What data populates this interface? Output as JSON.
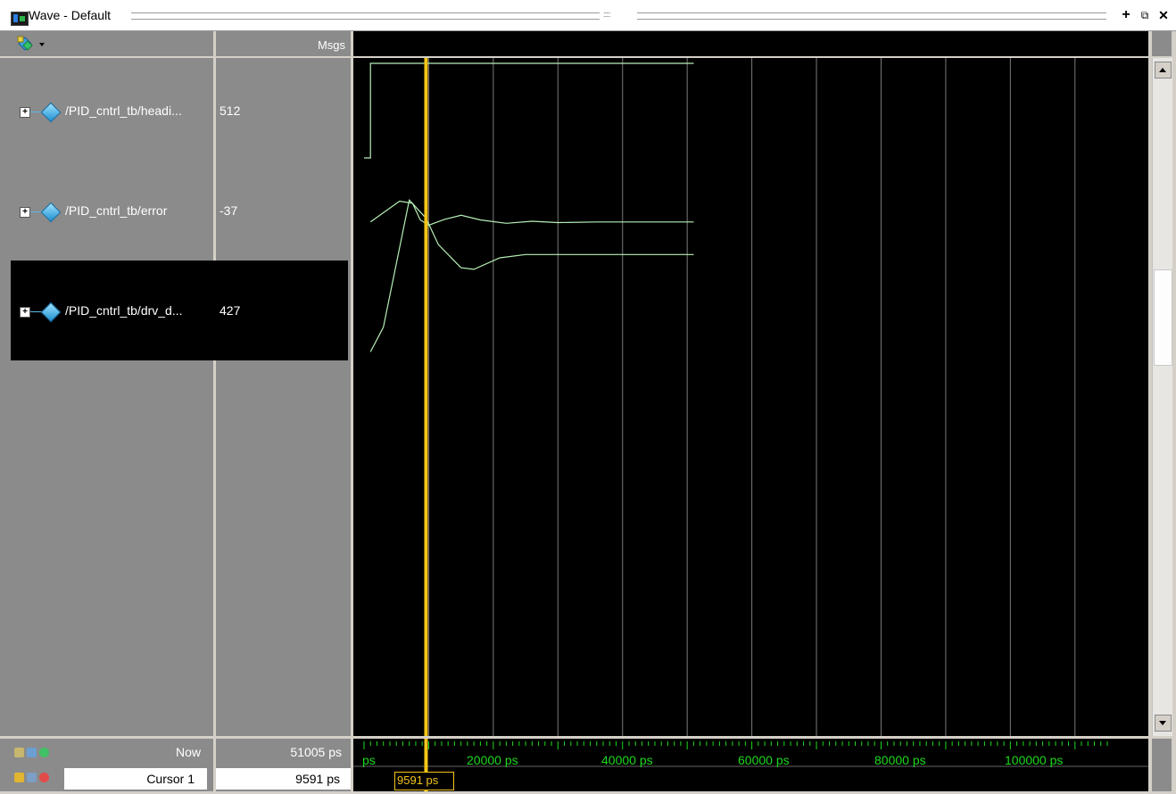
{
  "window": {
    "title": "Wave - Default",
    "grip": ":::::",
    "buttons": {
      "add": "+",
      "undock": "⧉",
      "close": "✕"
    }
  },
  "columns": {
    "msgs_header": "Msgs"
  },
  "signals": [
    {
      "name": "/PID_cntrl_tb/headi...",
      "value": "512",
      "expand": "+"
    },
    {
      "name": "/PID_cntrl_tb/error",
      "value": "-37",
      "expand": "+"
    },
    {
      "name": "/PID_cntrl_tb/drv_d...",
      "value": "427",
      "expand": "+"
    }
  ],
  "footer": {
    "now_label": "Now",
    "now_value": "51005 ps",
    "cursor_label": "Cursor 1",
    "cursor_value": "9591 ps",
    "cursor_tag": "9591 ps"
  },
  "timeline": {
    "start_label": "ps",
    "labels": [
      "20000 ps",
      "40000 ps",
      "60000 ps",
      "80000 ps",
      "100000 ps"
    ]
  },
  "chart_data": {
    "type": "line",
    "x_unit": "ps",
    "x_range": [
      0,
      115000
    ],
    "cursor_time": 9591,
    "now_time": 51005,
    "series": [
      {
        "name": "/PID_cntrl_tb/headi...",
        "points": [
          [
            0,
            0
          ],
          [
            1000,
            0
          ],
          [
            1000,
            1
          ],
          [
            51005,
            1
          ]
        ]
      },
      {
        "name": "/PID_cntrl_tb/error",
        "points": [
          [
            1000,
            0.55
          ],
          [
            5500,
            0.86
          ],
          [
            7500,
            0.83
          ],
          [
            8700,
            0.58
          ],
          [
            10000,
            0.5
          ],
          [
            12500,
            0.59
          ],
          [
            15000,
            0.65
          ],
          [
            18000,
            0.58
          ],
          [
            22000,
            0.53
          ],
          [
            26000,
            0.56
          ],
          [
            30000,
            0.54
          ],
          [
            36000,
            0.55
          ],
          [
            51005,
            0.55
          ]
        ]
      },
      {
        "name": "/PID_cntrl_tb/drv_d...",
        "points": [
          [
            1000,
            0.03
          ],
          [
            3000,
            0.18
          ],
          [
            7000,
            0.95
          ],
          [
            9600,
            0.84
          ],
          [
            11500,
            0.68
          ],
          [
            15000,
            0.54
          ],
          [
            17000,
            0.53
          ],
          [
            21000,
            0.6
          ],
          [
            25000,
            0.62
          ],
          [
            29000,
            0.62
          ],
          [
            34000,
            0.62
          ],
          [
            51005,
            0.62
          ]
        ]
      }
    ],
    "colors": {
      "wave": "#b6f0b6",
      "cursor": "#f5c518",
      "grid": "#7a7a7a",
      "axis": "#1fd81f"
    }
  }
}
